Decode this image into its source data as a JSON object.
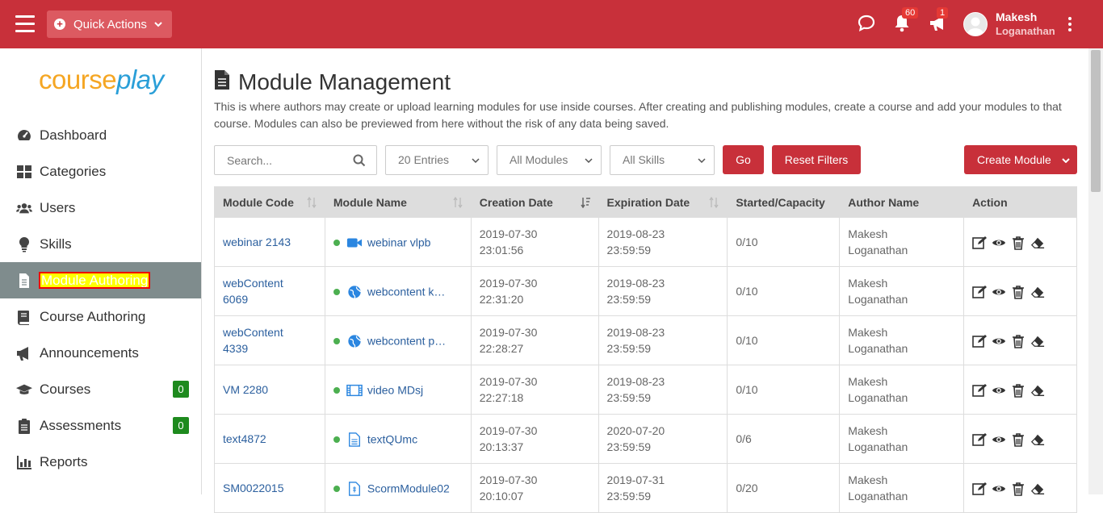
{
  "header": {
    "quick_actions_label": "Quick Actions",
    "notifications_count": "60",
    "announcements_count": "1",
    "user_first_name": "Makesh",
    "user_last_name": "Loganathan"
  },
  "logo": {
    "part1": "course",
    "part2": "play"
  },
  "sidebar": {
    "items": [
      {
        "label": "Dashboard",
        "icon": "dashboard-icon"
      },
      {
        "label": "Categories",
        "icon": "grid-icon"
      },
      {
        "label": "Users",
        "icon": "users-icon"
      },
      {
        "label": "Skills",
        "icon": "lightbulb-icon"
      },
      {
        "label": "Module Authoring",
        "icon": "file-icon",
        "active": true
      },
      {
        "label": "Course Authoring",
        "icon": "book-icon"
      },
      {
        "label": "Announcements",
        "icon": "megaphone-icon"
      },
      {
        "label": "Courses",
        "icon": "graduation-cap-icon",
        "badge": "0"
      },
      {
        "label": "Assessments",
        "icon": "clipboard-icon",
        "badge": "0"
      },
      {
        "label": "Reports",
        "icon": "bar-chart-icon"
      }
    ]
  },
  "page": {
    "title": "Module Management",
    "description": "This is where authors may create or upload learning modules for use inside courses. After creating and publishing modules, create a course and add your modules to that course. Modules can also be previewed from here without the risk of any data being saved."
  },
  "filters": {
    "search_placeholder": "Search...",
    "entries": "20 Entries",
    "modules": "All Modules",
    "skills": "All Skills",
    "go_label": "Go",
    "reset_label": "Reset Filters",
    "create_label": "Create Module"
  },
  "table": {
    "headers": [
      "Module Code",
      "Module Name",
      "Creation Date",
      "Expiration Date",
      "Started/Capacity",
      "Author Name",
      "Action"
    ],
    "rows": [
      {
        "code1": "webinar 2143",
        "code2": "",
        "type": "video",
        "name": "webinar vlpb",
        "c1": "2019-07-30",
        "c2": "23:01:56",
        "e1": "2019-08-23",
        "e2": "23:59:59",
        "cap": "0/10",
        "a1": "Makesh",
        "a2": "Loganathan"
      },
      {
        "code1": "webContent",
        "code2": "6069",
        "type": "globe",
        "name": "webcontent k…",
        "c1": "2019-07-30",
        "c2": "22:31:20",
        "e1": "2019-08-23",
        "e2": "23:59:59",
        "cap": "0/10",
        "a1": "Makesh",
        "a2": "Loganathan"
      },
      {
        "code1": "webContent",
        "code2": "4339",
        "type": "globe",
        "name": "webcontent p…",
        "c1": "2019-07-30",
        "c2": "22:28:27",
        "e1": "2019-08-23",
        "e2": "23:59:59",
        "cap": "0/10",
        "a1": "Makesh",
        "a2": "Loganathan"
      },
      {
        "code1": "VM 2280",
        "code2": "",
        "type": "film",
        "name": "video MDsj",
        "c1": "2019-07-30",
        "c2": "22:27:18",
        "e1": "2019-08-23",
        "e2": "23:59:59",
        "cap": "0/10",
        "a1": "Makesh",
        "a2": "Loganathan"
      },
      {
        "code1": "text4872",
        "code2": "",
        "type": "text",
        "name": "textQUmc",
        "c1": "2019-07-30",
        "c2": "20:13:37",
        "e1": "2020-07-20",
        "e2": "23:59:59",
        "cap": "0/6",
        "a1": "Makesh",
        "a2": "Loganathan"
      },
      {
        "code1": "SM0022015",
        "code2": "",
        "type": "scorm",
        "name": "ScormModule02",
        "c1": "2019-07-30",
        "c2": "20:10:07",
        "e1": "2019-07-31",
        "e2": "23:59:59",
        "cap": "0/20",
        "a1": "Makesh",
        "a2": "Loganathan"
      }
    ]
  },
  "colors": {
    "brand_red": "#c8303a",
    "active_nav": "#7f8c8d",
    "link_blue": "#2b5f9e",
    "badge_green": "#1e8a1e"
  }
}
